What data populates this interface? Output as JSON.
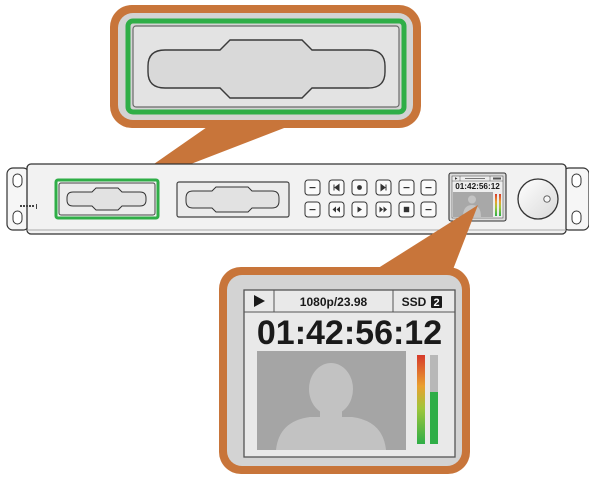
{
  "lcd": {
    "play_icon": "play-triangle",
    "format": "1080p/23.98",
    "media_label": "SSD",
    "media_slot": "2",
    "timecode": "01:42:56:12"
  },
  "front_panel": {
    "logo_text": "Blackmagic",
    "transport_buttons_top": [
      "rew-icon",
      "prev-clip-icon",
      "record-icon",
      "next-clip-icon",
      "fwd-icon",
      "menu-icon"
    ],
    "transport_buttons_bottom": [
      "jog-icon",
      "fast-rewind-icon",
      "play-icon",
      "fast-forward-icon",
      "stop-icon",
      "shuttle-icon"
    ]
  },
  "colors": {
    "callout_orange": "#c8753a",
    "callout_fill": "#d5d5d5",
    "slot_highlight_green": "#2fae47",
    "panel_fill": "#f2f2f2",
    "lcd_bg": "#e9e9e9",
    "meter_red": "#d63a2b",
    "meter_green": "#2fae47"
  }
}
